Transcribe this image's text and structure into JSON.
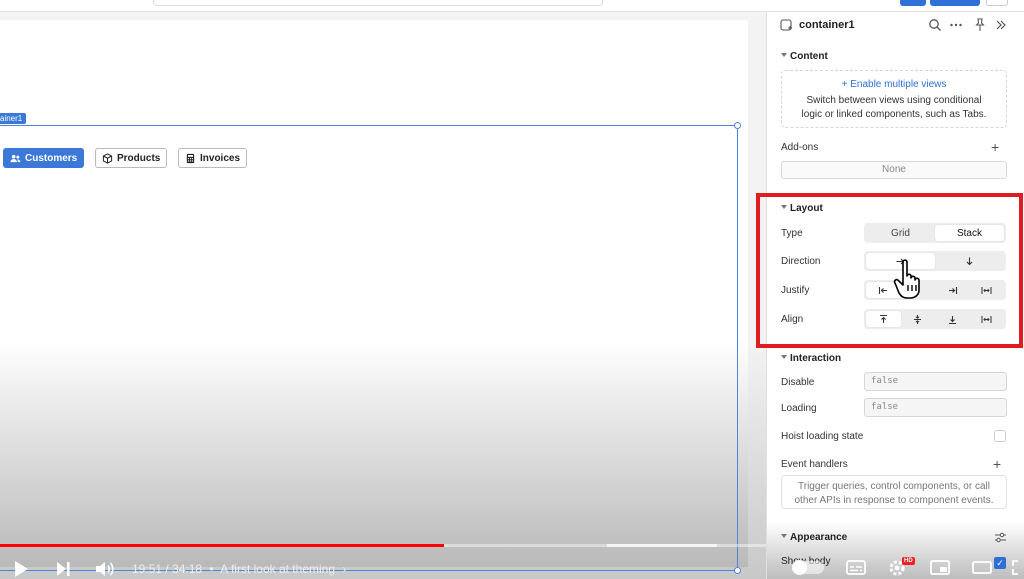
{
  "canvas": {
    "container_label": "ainer1",
    "tabs": [
      {
        "label": "Customers",
        "icon": "users-icon",
        "active": true
      },
      {
        "label": "Products",
        "icon": "box-icon",
        "active": false
      },
      {
        "label": "Invoices",
        "icon": "calculator-icon",
        "active": false
      }
    ]
  },
  "panel": {
    "title": "container1",
    "content": {
      "title": "Content",
      "enable_link": "+ Enable multiple views",
      "description_line1": "Switch between views using conditional",
      "description_line2": "logic or linked components, such as Tabs.",
      "addons_label": "Add-ons",
      "addons_value": "None"
    },
    "layout": {
      "title": "Layout",
      "type_label": "Type",
      "type_options": [
        "Grid",
        "Stack"
      ],
      "type_selected": "Stack",
      "direction_label": "Direction",
      "justify_label": "Justify",
      "align_label": "Align"
    },
    "interaction": {
      "title": "Interaction",
      "disable_label": "Disable",
      "disable_value": "false",
      "loading_label": "Loading",
      "loading_value": "false",
      "hoist_label": "Hoist loading state",
      "event_label": "Event handlers",
      "event_line1": "Trigger queries, control components, or call",
      "event_line2": "other APIs in response to component events."
    },
    "appearance": {
      "title": "Appearance",
      "show_body_label": "Show body"
    }
  },
  "video": {
    "time": "19:51 / 34:18",
    "separator": "•",
    "chapter": "A first look at theming",
    "progress_fraction": 0.579,
    "hd_badge": "HD"
  },
  "colors": {
    "accent": "#3b78d8",
    "highlight": "#e01b22",
    "progress": "#ff0000"
  }
}
